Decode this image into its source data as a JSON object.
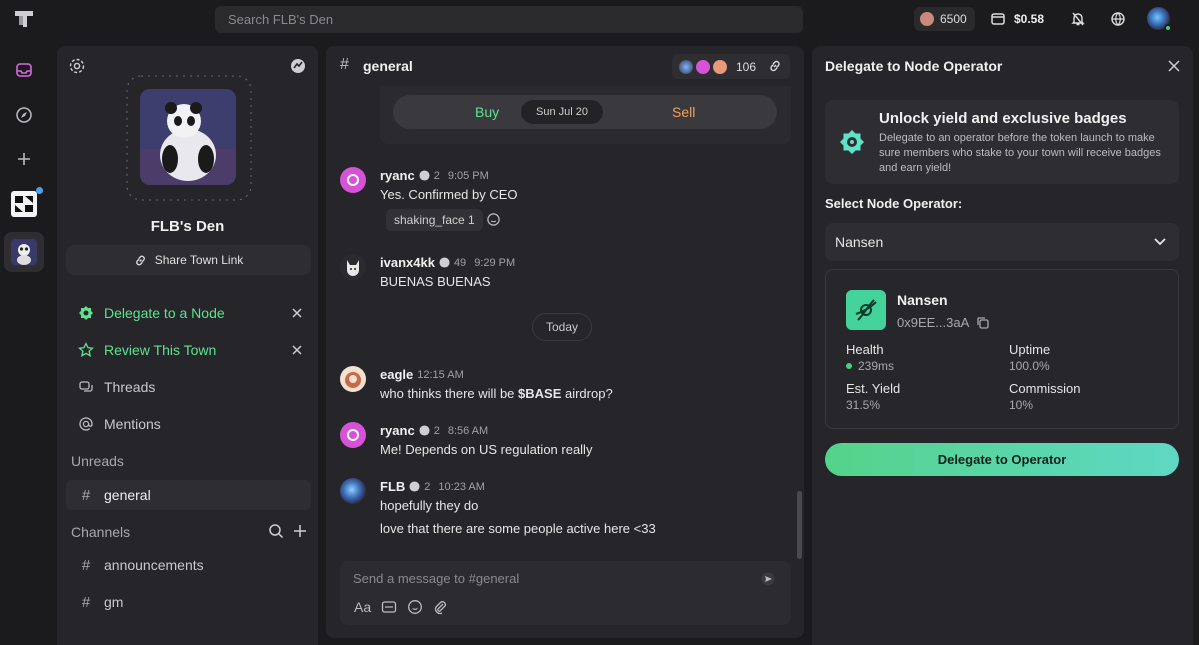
{
  "topbar": {
    "search_placeholder": "Search FLB's Den",
    "points": "6500",
    "balance": "$0.58"
  },
  "town": {
    "name": "FLB's Den",
    "share_label": "Share Town Link"
  },
  "sidebar": {
    "actions": [
      {
        "label": "Delegate to a Node",
        "icon": "node-badge-icon"
      },
      {
        "label": "Review This Town",
        "icon": "star-icon"
      }
    ],
    "items": [
      {
        "label": "Threads",
        "icon": "threads-icon"
      },
      {
        "label": "Mentions",
        "icon": "at-icon"
      }
    ],
    "unreads_label": "Unreads",
    "unread_channels": [
      "general"
    ],
    "channels_label": "Channels",
    "channels": [
      "announcements",
      "gm"
    ]
  },
  "channel": {
    "name": "general",
    "member_count": "106",
    "trade": {
      "buy": "Buy",
      "sell": "Sell",
      "date": "Sun Jul 20"
    },
    "today_label": "Today",
    "composer_placeholder": "Send a message to #general",
    "composer_font_label": "Aa"
  },
  "messages": [
    {
      "user": "ryanc",
      "level": "2",
      "time": "9:05 PM",
      "text": "Yes. Confirmed by CEO",
      "reaction": "shaking_face 1"
    },
    {
      "user": "ivanx4kk",
      "level": "49",
      "time": "9:29 PM",
      "text": "BUENAS BUENAS"
    },
    {
      "user": "eagle",
      "time": "12:15 AM",
      "text_before": "who thinks there will be ",
      "text_bold": "$BASE",
      "text_after": " airdrop?"
    },
    {
      "user": "ryanc",
      "level": "2",
      "time": "8:56 AM",
      "text": "Me! Depends on US regulation really"
    },
    {
      "user": "FLB",
      "level": "2",
      "time": "10:23 AM",
      "text": "hopefully they do",
      "text2": "love that there are some people active here <33"
    }
  ],
  "panel": {
    "title": "Delegate to Node Operator",
    "promo_title": "Unlock yield and exclusive badges",
    "promo_text": "Delegate to an operator before the token launch to make sure members who stake to your town will receive badges and earn yield!",
    "select_label": "Select Node Operator:",
    "selected": "Nansen",
    "operator": {
      "name": "Nansen",
      "address": "0x9EE...3aA",
      "health_label": "Health",
      "health_value": "239ms",
      "uptime_label": "Uptime",
      "uptime_value": "100.0%",
      "yield_label": "Est. Yield",
      "yield_value": "31.5%",
      "commission_label": "Commission",
      "commission_value": "10%"
    },
    "cta": "Delegate to Operator"
  },
  "colors": {
    "accent_green": "#5ee28f",
    "sell_orange": "#f0a060",
    "cta_gradient_start": "#54d38a",
    "cta_gradient_end": "#5ed8c4"
  }
}
